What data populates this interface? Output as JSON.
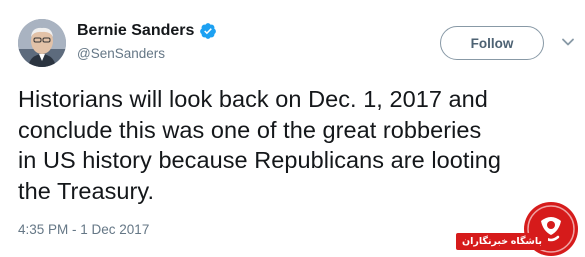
{
  "tweet": {
    "display_name": "Bernie Sanders",
    "handle": "@SenSanders",
    "follow_label": "Follow",
    "lines": [
      "Historians will look back on Dec. 1, 2017 and",
      "conclude this was one of the great robberies",
      "in US history because Republicans are looting",
      "the Treasury."
    ],
    "timestamp": "4:35 PM - 1 Dec 2017"
  },
  "watermark": {
    "text": "باشگاه خبرنگاران"
  },
  "icons": {
    "verified": "verified-badge-icon",
    "caret": "chevron-down-icon",
    "watermark_logo": "club-logo-icon"
  },
  "colors": {
    "verified_blue": "#1da1f2",
    "text_primary": "#14171a",
    "text_secondary": "#657786",
    "watermark_red": "#d61b1b"
  }
}
